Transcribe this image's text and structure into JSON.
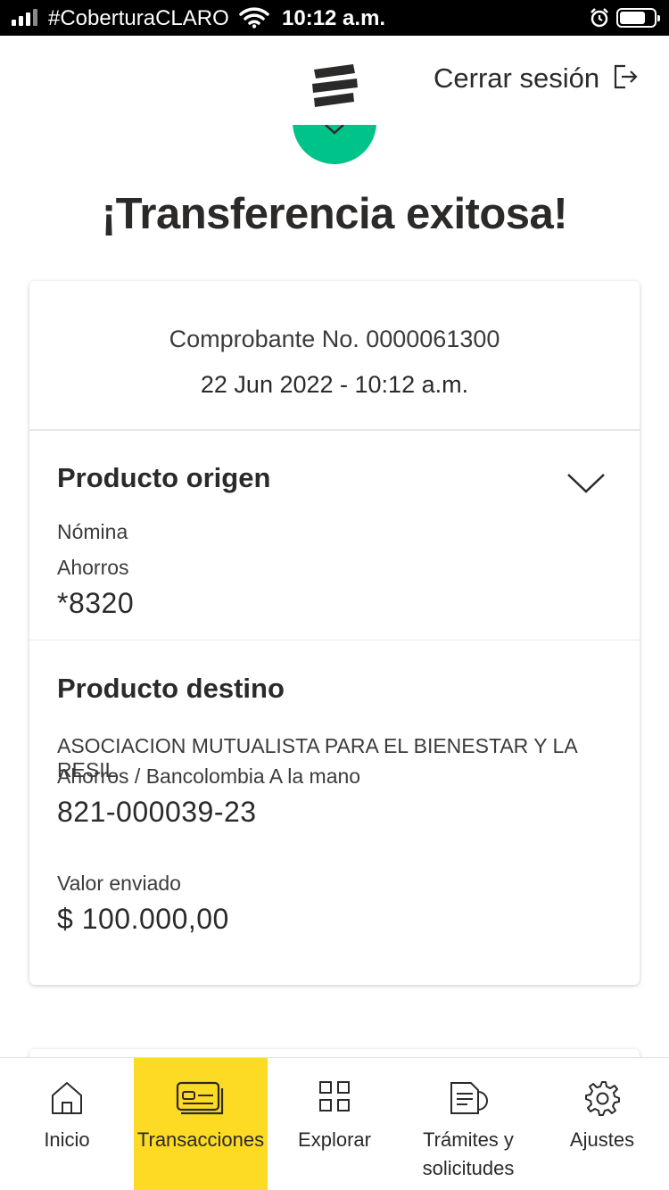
{
  "status_bar": {
    "carrier": "#CoberturaCLARO",
    "time": "10:12 a.m."
  },
  "header": {
    "logout_label": "Cerrar sesión",
    "success_color": "#00c389"
  },
  "title": "¡Transferencia exitosa!",
  "receipt": {
    "number": "Comprobante No. 0000061300",
    "date": "22 Jun 2022 - 10:12 a.m."
  },
  "origin": {
    "heading": "Producto origen",
    "type": "Nómina",
    "account_type": "Ahorros",
    "account_number": "*8320"
  },
  "destination": {
    "heading": "Producto destino",
    "name": "ASOCIACION MUTUALISTA PARA EL BIENESTAR Y LA RESIL",
    "account_type": "Ahorros / Bancolombia A la mano",
    "account_number": "821-000039-23",
    "amount_label": "Valor enviado",
    "amount": "$ 100.000,00"
  },
  "bottom_nav": {
    "active_color": "#fdda24",
    "items": [
      {
        "label": "Inicio",
        "icon": "home-icon"
      },
      {
        "label": "Transacciones",
        "icon": "cards-icon"
      },
      {
        "label": "Explorar",
        "icon": "grid-icon"
      },
      {
        "label": "Trámites y solicitudes",
        "icon": "documents-icon"
      },
      {
        "label": "Ajustes",
        "icon": "gear-icon"
      }
    ]
  }
}
